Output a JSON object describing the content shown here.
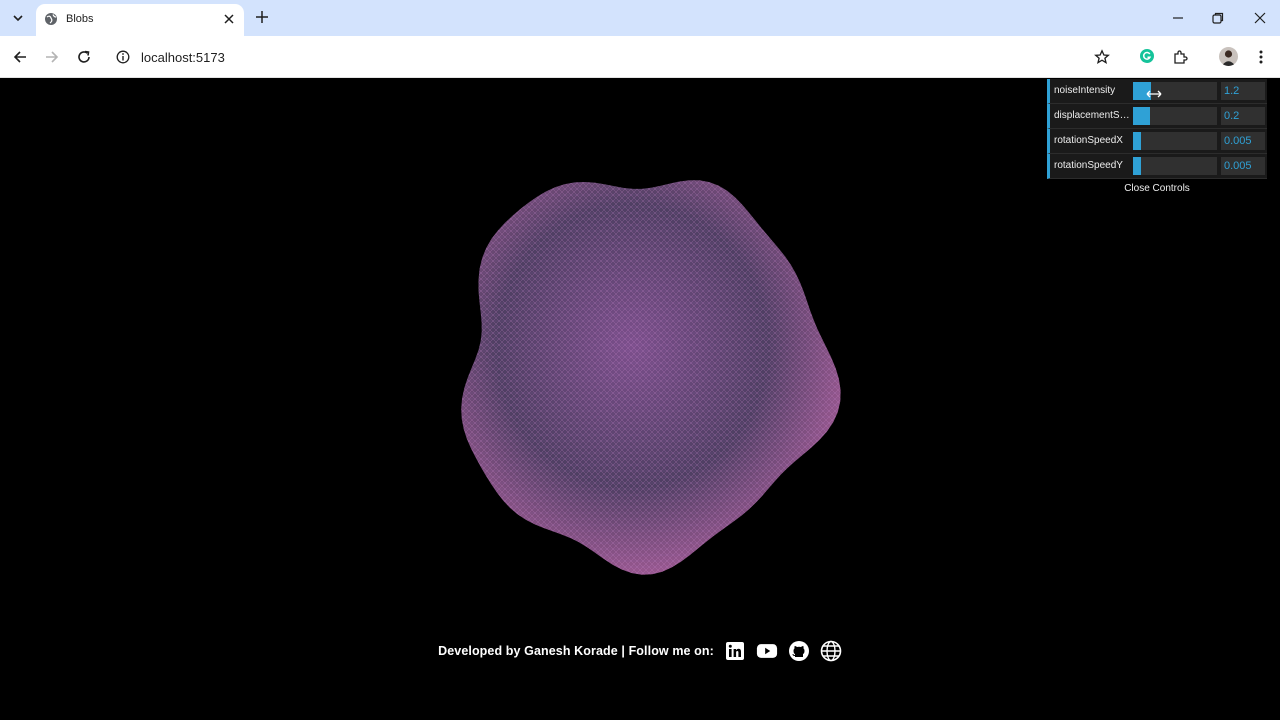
{
  "browser": {
    "tab_title": "Blobs",
    "url": "localhost:5173"
  },
  "controls": {
    "rows": [
      {
        "label": "noiseIntensity",
        "value": "1.2",
        "fill": 0.22
      },
      {
        "label": "displacementStrength",
        "value": "0.2",
        "fill": 0.2
      },
      {
        "label": "rotationSpeedX",
        "value": "0.005",
        "fill": 0.1
      },
      {
        "label": "rotationSpeedY",
        "value": "0.005",
        "fill": 0.1
      }
    ],
    "close_label": "Close Controls",
    "accent": "#2fa1d6"
  },
  "footer": {
    "text": "Developed by Ganesh Korade | Follow me on:",
    "icons": [
      "linkedin-icon",
      "youtube-icon",
      "github-icon",
      "globe-icon"
    ]
  },
  "blob": {
    "colors": [
      "#b0609e",
      "#7c4f8c",
      "#4f3f63"
    ]
  }
}
